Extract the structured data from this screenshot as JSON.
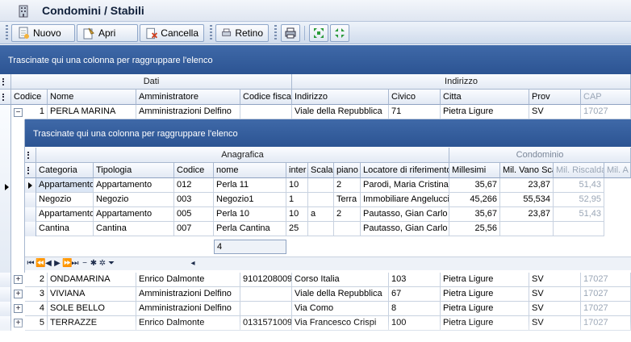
{
  "window": {
    "title": "Condomini / Stabili"
  },
  "toolbar": {
    "nuovo_label": "Nuovo",
    "apri_label": "Apri",
    "cancella_label": "Cancella",
    "retino_label": "Retino"
  },
  "group_panel": {
    "text": "Trascinate qui una colonna per raggruppare l'elenco"
  },
  "main_grid": {
    "bands": {
      "dati": "Dati",
      "indirizzo": "Indirizzo"
    },
    "columns": [
      "Codice",
      "Nome",
      "Amministratore",
      "Codice fiscal",
      "Indirizzo",
      "Civico",
      "Citta",
      "Prov",
      "CAP"
    ],
    "rows": [
      {
        "codice": "1",
        "nome": "PERLA MARINA",
        "amministratore": "Amministrazioni Delfino",
        "codice_fiscale": "",
        "indirizzo": "Viale della Repubblica",
        "civico": "71",
        "citta": "Pietra Ligure",
        "prov": "SV",
        "cap": "17027"
      },
      {
        "codice": "2",
        "nome": "ONDAMARINA",
        "amministratore": "Enrico Dalmonte",
        "codice_fiscale": "9101208009",
        "indirizzo": "Corso Italia",
        "civico": "103",
        "citta": "Pietra Ligure",
        "prov": "SV",
        "cap": "17027"
      },
      {
        "codice": "3",
        "nome": "VIVIANA",
        "amministratore": "Amministrazioni Delfino",
        "codice_fiscale": "",
        "indirizzo": "Viale della Repubblica",
        "civico": "67",
        "citta": "Pietra Ligure",
        "prov": "SV",
        "cap": "17027"
      },
      {
        "codice": "4",
        "nome": "SOLE BELLO",
        "amministratore": "Amministrazioni Delfino",
        "codice_fiscale": "",
        "indirizzo": "Via Como",
        "civico": "8",
        "citta": "Pietra Ligure",
        "prov": "SV",
        "cap": "17027"
      },
      {
        "codice": "5",
        "nome": "TERRAZZE",
        "amministratore": "Enrico Dalmonte",
        "codice_fiscale": "0131571009",
        "indirizzo": "Via Francesco Crispi",
        "civico": "100",
        "citta": "Pietra Ligure",
        "prov": "SV",
        "cap": "17027"
      }
    ]
  },
  "detail_grid": {
    "group_text": "Trascinate qui una colonna per raggruppare l'elenco",
    "bands": {
      "anagrafica": "Anagrafica",
      "condominio": "Condominio"
    },
    "columns": [
      "Categoria",
      "Tipologia",
      "Codice",
      "nome",
      "inter",
      "Scala",
      "piano",
      "Locatore di riferimento",
      "Millesimi",
      "Mil. Vano Sca",
      "Mil. Riscalda",
      "Mil. A"
    ],
    "rows": [
      {
        "categoria": "Appartamento",
        "tipologia": "Appartamento",
        "codice": "012",
        "nome": "Perla 11",
        "inter": "10",
        "scala": "",
        "piano": "2",
        "locatore": "Parodi, Maria Cristina",
        "millesimi": "35,67",
        "mil_vano": "23,87",
        "mil_risc": "51,43"
      },
      {
        "categoria": "Negozio",
        "tipologia": "Negozio",
        "codice": "003",
        "nome": "Negozio1",
        "inter": "1",
        "scala": "",
        "piano": "Terra",
        "locatore": "Immobiliare Angelucci",
        "millesimi": "45,266",
        "mil_vano": "55,534",
        "mil_risc": "52,95"
      },
      {
        "categoria": "Appartamento",
        "tipologia": "Appartamento",
        "codice": "005",
        "nome": "Perla 10",
        "inter": "10",
        "scala": "a",
        "piano": "2",
        "locatore": "Pautasso, Gian Carlo",
        "millesimi": "35,67",
        "mil_vano": "23,87",
        "mil_risc": "51,43"
      },
      {
        "categoria": "Cantina",
        "tipologia": "Cantina",
        "codice": "007",
        "nome": "Perla Cantina",
        "inter": "25",
        "scala": "",
        "piano": "",
        "locatore": "Pautasso, Gian Carlo",
        "millesimi": "25,56",
        "mil_vano": "",
        "mil_risc": ""
      }
    ],
    "footer_count": "4"
  }
}
